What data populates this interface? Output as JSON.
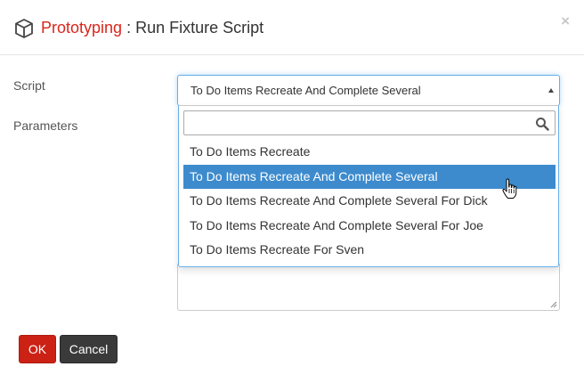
{
  "header": {
    "brand": "Prototyping",
    "separator": " : ",
    "title": "Run Fixture Script",
    "close": "×"
  },
  "form": {
    "script_label": "Script",
    "parameters_label": "Parameters",
    "selected_script": "To Do Items Recreate And Complete Several"
  },
  "dropdown": {
    "search_value": "",
    "options": [
      "To Do Items Recreate",
      "To Do Items Recreate And Complete Several",
      "To Do Items Recreate And Complete Several For Dick",
      "To Do Items Recreate And Complete Several For Joe",
      "To Do Items Recreate For Sven"
    ],
    "highlighted_index": 1
  },
  "buttons": {
    "ok": "OK",
    "cancel": "Cancel"
  },
  "colors": {
    "brand": "#d9261c",
    "highlight": "#3d8bcd",
    "ok_button": "#cc2115",
    "cancel_button": "#3a3a3a"
  },
  "icons": {
    "header": "cube-icon",
    "search": "magnifier-icon",
    "cursor": "hand-pointer-icon"
  }
}
